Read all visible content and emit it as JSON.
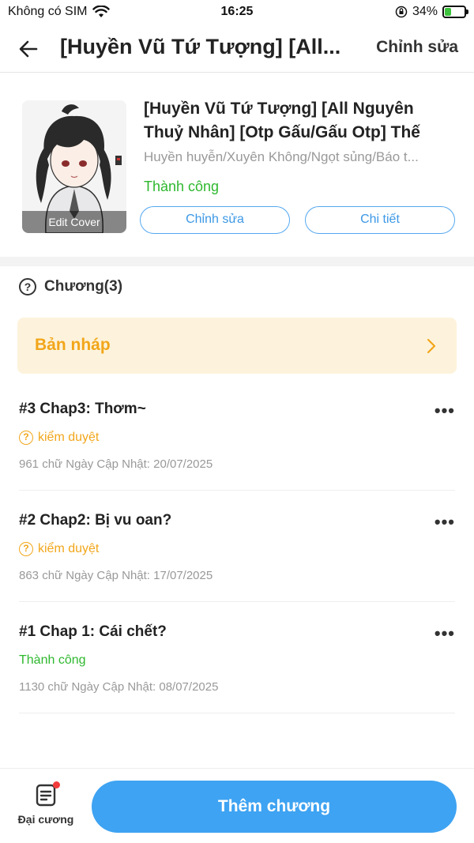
{
  "status_bar": {
    "carrier": "Không có SIM",
    "time": "16:25",
    "battery_text": "34%",
    "battery_level": 0.34
  },
  "nav": {
    "title": "[Huyền Vũ Tứ Tượng] [All...",
    "edit_label": "Chỉnh sửa"
  },
  "book": {
    "cover_label": "Edit Cover",
    "title": "[Huyền Vũ Tứ Tượng] [All Nguyên Thuỷ Nhân] [Otp Gấu/Gấu Otp] Thế",
    "genres": "Huyền huyễn/Xuyên Không/Ngọt sủng/Báo t...",
    "status": "Thành công",
    "edit_button": "Chỉnh sửa",
    "detail_button": "Chi tiết"
  },
  "chapters_header": {
    "icon": "?",
    "label": "Chương(3)"
  },
  "draft": {
    "label": "Bản nháp"
  },
  "chapters": [
    {
      "title": "#3 Chap3: Thơm~",
      "status": "kiểm duyệt",
      "status_type": "pending",
      "meta": "961 chữ Ngày Cập Nhật: 20/07/2025"
    },
    {
      "title": "#2 Chap2: Bị vu oan?",
      "status": "kiểm duyệt",
      "status_type": "pending",
      "meta": "863 chữ Ngày Cập Nhật: 17/07/2025"
    },
    {
      "title": "#1 Chap 1: Cái chết?",
      "status": "Thành công",
      "status_type": "success",
      "meta": "1130 chữ Ngày Cập Nhật: 08/07/2025"
    }
  ],
  "bottom": {
    "outline_label": "Đại cương",
    "add_button": "Thêm chương"
  },
  "colors": {
    "accent": "#3ea3f2",
    "success": "#2eb82e",
    "warning": "#f2a61a",
    "draft_bg": "#fdf3dc"
  }
}
